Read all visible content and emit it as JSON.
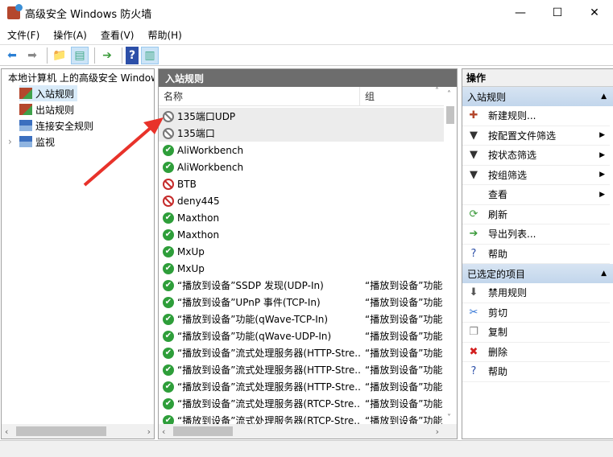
{
  "window": {
    "title": "高级安全 Windows 防火墙",
    "minimize": "—",
    "maximize": "☐",
    "close": "✕"
  },
  "menu": [
    "文件(F)",
    "操作(A)",
    "查看(V)",
    "帮助(H)"
  ],
  "tree": {
    "root": "本地计算机 上的高级安全 Windows",
    "items": [
      "入站规则",
      "出站规则",
      "连接安全规则",
      "监视"
    ],
    "expander": "›"
  },
  "middle": {
    "title": "入站规则",
    "col_name": "名称",
    "col_group": "组",
    "rows": [
      {
        "name": "135端口UDP",
        "group": "",
        "status": "disabled"
      },
      {
        "name": "135端口",
        "group": "",
        "status": "disabled"
      },
      {
        "name": "AliWorkbench",
        "group": "",
        "status": "allow"
      },
      {
        "name": "AliWorkbench",
        "group": "",
        "status": "allow"
      },
      {
        "name": "BTB",
        "group": "",
        "status": "block"
      },
      {
        "name": "deny445",
        "group": "",
        "status": "block"
      },
      {
        "name": "Maxthon",
        "group": "",
        "status": "allow"
      },
      {
        "name": "Maxthon",
        "group": "",
        "status": "allow"
      },
      {
        "name": "MxUp",
        "group": "",
        "status": "allow"
      },
      {
        "name": "MxUp",
        "group": "",
        "status": "allow"
      },
      {
        "name": "“播放到设备”SSDP 发现(UDP-In)",
        "group": "“播放到设备”功能",
        "status": "allow"
      },
      {
        "name": "“播放到设备”UPnP 事件(TCP-In)",
        "group": "“播放到设备”功能",
        "status": "allow"
      },
      {
        "name": "“播放到设备”功能(qWave-TCP-In)",
        "group": "“播放到设备”功能",
        "status": "allow"
      },
      {
        "name": "“播放到设备”功能(qWave-UDP-In)",
        "group": "“播放到设备”功能",
        "status": "allow"
      },
      {
        "name": "“播放到设备”流式处理服务器(HTTP-Stre...",
        "group": "“播放到设备”功能",
        "status": "allow"
      },
      {
        "name": "“播放到设备”流式处理服务器(HTTP-Stre...",
        "group": "“播放到设备”功能",
        "status": "allow"
      },
      {
        "name": "“播放到设备”流式处理服务器(HTTP-Stre...",
        "group": "“播放到设备”功能",
        "status": "allow"
      },
      {
        "name": "“播放到设备”流式处理服务器(RTCP-Stre...",
        "group": "“播放到设备”功能",
        "status": "allow"
      },
      {
        "name": "“播放到设备”流式处理服务器(RTCP-Stre...",
        "group": "“播放到设备”功能",
        "status": "allow"
      }
    ]
  },
  "actions": {
    "title": "操作",
    "section1": {
      "title": "入站规则",
      "items": [
        {
          "label": "新建规则...",
          "icon": "new-rule-icon",
          "glyph": "✚",
          "sub": false
        },
        {
          "label": "按配置文件筛选",
          "icon": "filter-icon",
          "glyph": "▼",
          "sub": true
        },
        {
          "label": "按状态筛选",
          "icon": "filter-icon",
          "glyph": "▼",
          "sub": true
        },
        {
          "label": "按组筛选",
          "icon": "filter-icon",
          "glyph": "▼",
          "sub": true
        },
        {
          "label": "查看",
          "icon": "",
          "glyph": "",
          "sub": true
        },
        {
          "label": "刷新",
          "icon": "refresh-icon",
          "glyph": "⟳",
          "sub": false
        },
        {
          "label": "导出列表...",
          "icon": "export-icon",
          "glyph": "➔",
          "sub": false
        },
        {
          "label": "帮助",
          "icon": "help-icon",
          "glyph": "?",
          "sub": false
        }
      ]
    },
    "section2": {
      "title": "已选定的项目",
      "items": [
        {
          "label": "禁用规则",
          "icon": "disable-icon",
          "glyph": "⬇",
          "sub": false
        },
        {
          "label": "剪切",
          "icon": "cut-icon",
          "glyph": "✂",
          "sub": false
        },
        {
          "label": "复制",
          "icon": "copy-icon",
          "glyph": "❐",
          "sub": false
        },
        {
          "label": "删除",
          "icon": "delete-icon",
          "glyph": "✖",
          "sub": false
        },
        {
          "label": "帮助",
          "icon": "help-icon",
          "glyph": "?",
          "sub": false
        }
      ]
    }
  },
  "colors": {
    "accent_arrow": "#e8322a",
    "allow": "#2e9e3a",
    "block": "#c52b2b"
  }
}
